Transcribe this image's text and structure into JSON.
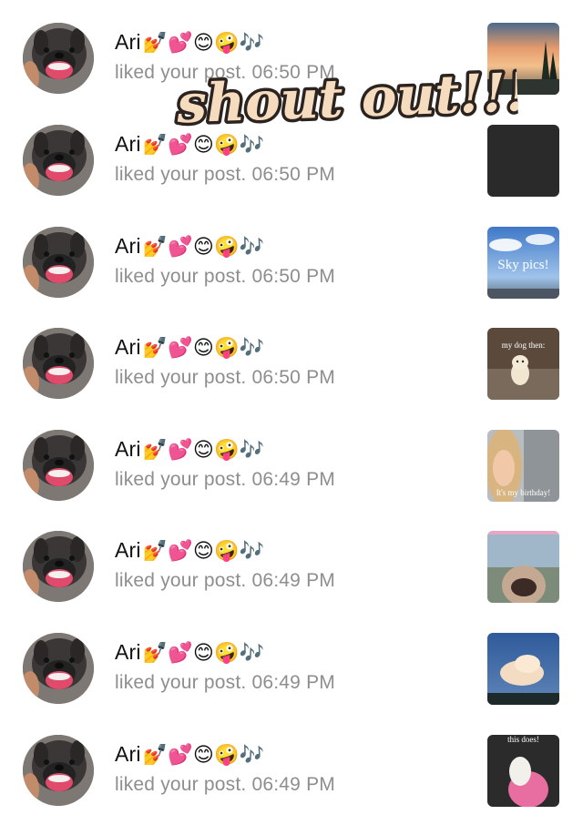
{
  "notifications": [
    {
      "user": "Ari",
      "emojis": "💅💕😊🤪🎶",
      "action": "liked your post.",
      "time": "06:50 PM",
      "thumb": "sunset-trees-photo",
      "caption": ""
    },
    {
      "user": "Ari",
      "emojis": "💅💕😊🤪🎶",
      "action": "liked your post.",
      "time": "06:50 PM",
      "thumb": "dark-photo",
      "caption": ""
    },
    {
      "user": "Ari",
      "emojis": "💅💕😊🤪🎶",
      "action": "liked your post.",
      "time": "06:50 PM",
      "thumb": "sky-photo",
      "caption": "Sky pics!"
    },
    {
      "user": "Ari",
      "emojis": "💅💕😊🤪🎶",
      "action": "liked your post.",
      "time": "06:50 PM",
      "thumb": "puppy-photo",
      "caption": "my dog then:"
    },
    {
      "user": "Ari",
      "emojis": "💅💕😊🤪🎶",
      "action": "liked your post.",
      "time": "06:49 PM",
      "thumb": "selfie-photo",
      "caption": "It's my birthday!"
    },
    {
      "user": "Ari",
      "emojis": "💅💕😊🤪🎶",
      "action": "liked your post.",
      "time": "06:49 PM",
      "thumb": "dog-nose-photo",
      "caption": ""
    },
    {
      "user": "Ari",
      "emojis": "💅💕😊🤪🎶",
      "action": "liked your post.",
      "time": "06:49 PM",
      "thumb": "cloud-photo",
      "caption": ""
    },
    {
      "user": "Ari",
      "emojis": "💅💕😊🤪🎶",
      "action": "liked your post.",
      "time": "06:49 PM",
      "thumb": "shoe-photo",
      "caption": "this does!"
    }
  ],
  "overlay_text": "shout out!!!",
  "colors": {
    "overlay_fill": "#f6dcbf",
    "overlay_stroke": "#2b2320",
    "secondary_text": "#8e8e8e"
  }
}
